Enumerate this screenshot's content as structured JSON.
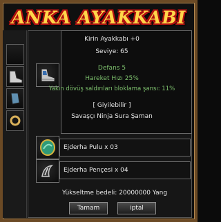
{
  "banner": {
    "text": "ANKA AYAKKABI"
  },
  "item": {
    "name": "Kirin Ayakkabı +0",
    "level": "Seviye: 65",
    "defense": "Defans 5",
    "move_speed": "Hareket Hızı 25%",
    "block_chance": "Yakın dövüş saldırıları bloklama şansı: 11%",
    "wearable": "[ Giyilebilir ]",
    "classes": "Savaşçı Ninja Sura Şaman",
    "icon": "shoe-icon"
  },
  "materials": [
    {
      "label": "Ejderha Pulu x 03",
      "icon": "dragon-scale-icon"
    },
    {
      "label": "Ejderha Pençesi x 04",
      "icon": "dragon-claw-icon"
    }
  ],
  "cost": {
    "text": "Yükseltme bedeli: 20000000 Yang"
  },
  "buttons": {
    "ok": "Tamam",
    "cancel": "iptal"
  },
  "colors": {
    "stat_green": "#7ec16e",
    "banner_gold": "#ffd64a",
    "banner_red": "#b11010",
    "frame_wood": "#6b4a25"
  }
}
